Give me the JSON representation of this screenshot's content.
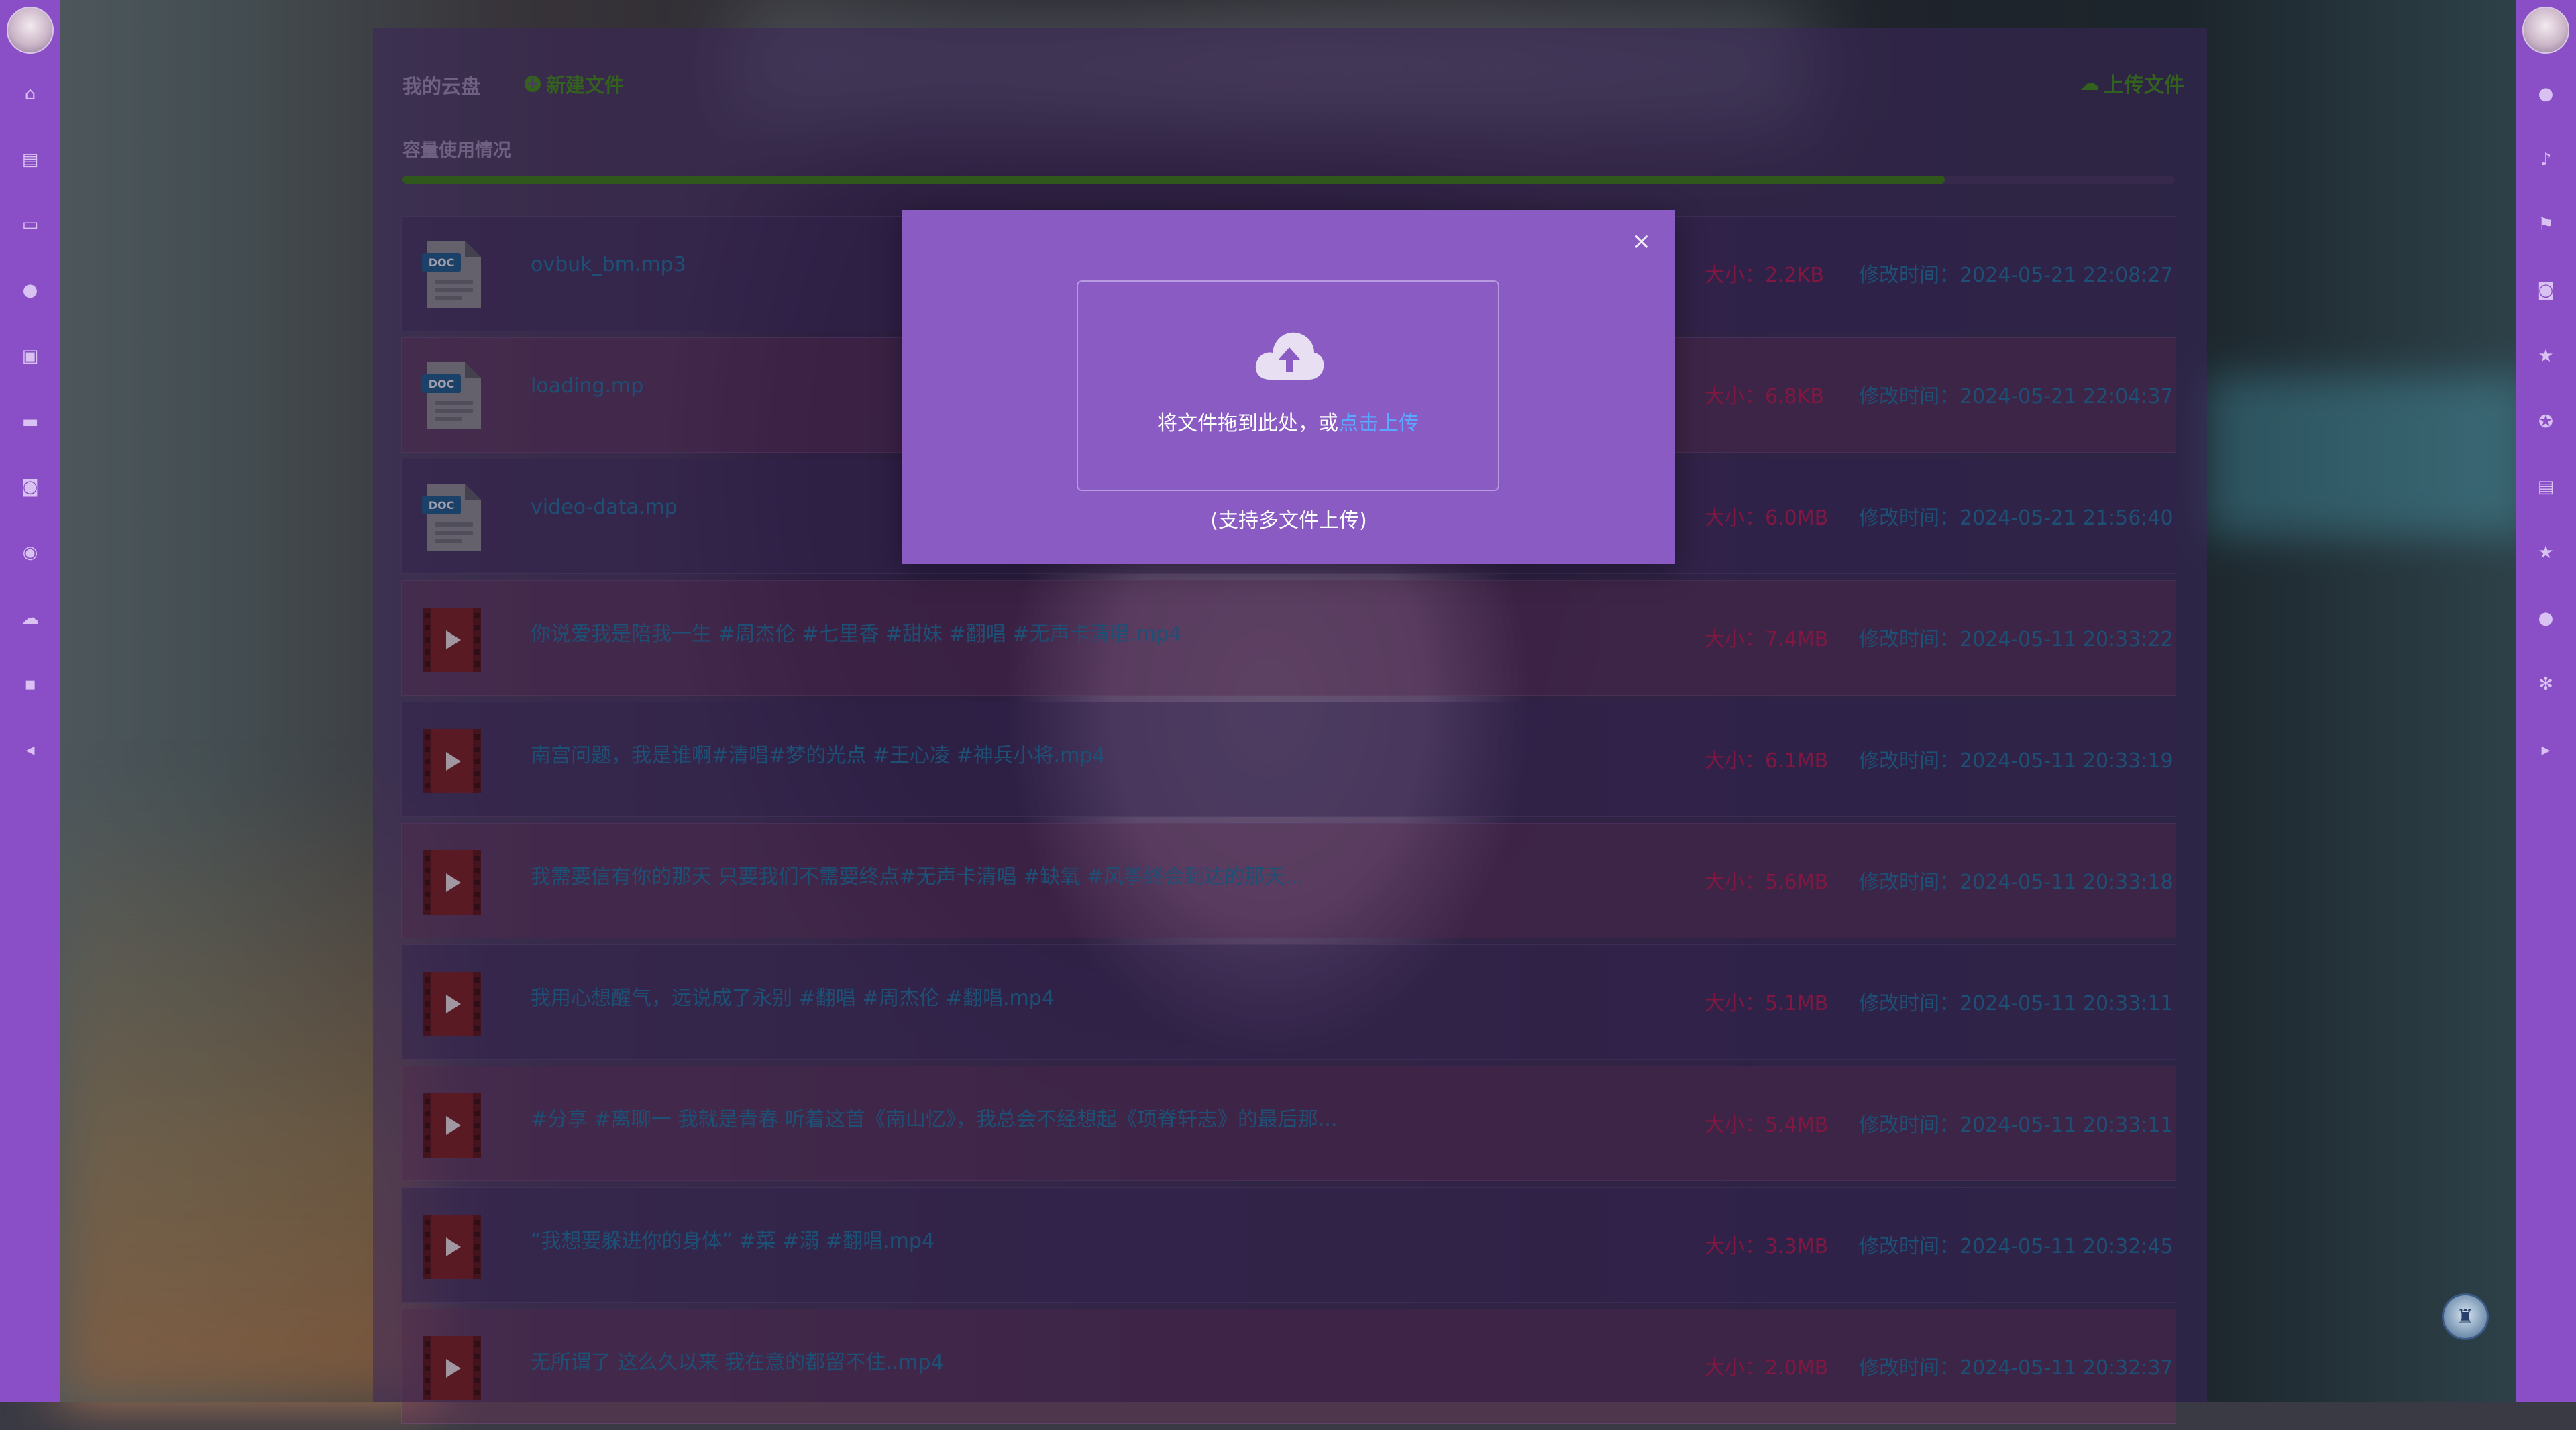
{
  "header": {
    "title": "我的云盘",
    "new_file_label": "新建文件",
    "upload_label": "上传文件",
    "capacity_label": "容量使用情况",
    "capacity_used_fraction": 0.87
  },
  "files": [
    {
      "name": "ovbuk_bm.mp3",
      "size": "大小：2.2KB",
      "modified": "修改时间：2024-05-21 22:08:27",
      "type": "doc"
    },
    {
      "name": "loading.mp",
      "size": "大小：6.8KB",
      "modified": "修改时间：2024-05-21 22:04:37",
      "type": "doc"
    },
    {
      "name": "video-data.mp",
      "size": "大小：6.0MB",
      "modified": "修改时间：2024-05-21 21:56:40",
      "type": "doc"
    },
    {
      "name": "你说爱我是陪我一生 #周杰伦 #七里香 #甜妹 #翻唱 #无声卡清唱.mp4",
      "size": "大小：7.4MB",
      "modified": "修改时间：2024-05-11 20:33:22",
      "type": "video"
    },
    {
      "name": "南宫问题，我是谁啊#清唱#梦的光点 #王心凌 #神兵小将.mp4",
      "size": "大小：6.1MB",
      "modified": "修改时间：2024-05-11 20:33:19",
      "type": "video"
    },
    {
      "name": "我需要信有你的那天 只要我们不需要终点#无声卡清唱 #缺氧 #风筝终会到达的那天...",
      "size": "大小：5.6MB",
      "modified": "修改时间：2024-05-11 20:33:18",
      "type": "video"
    },
    {
      "name": "我用心想醒气，远说成了永别 #翻唱 #周杰伦 #翻唱.mp4",
      "size": "大小：5.1MB",
      "modified": "修改时间：2024-05-11 20:33:11",
      "type": "video"
    },
    {
      "name": "#分享 #离聊一 我就是青春 听着这首《南山忆》，我总会不经想起《项脊轩志》的最后那...",
      "size": "大小：5.4MB",
      "modified": "修改时间：2024-05-11 20:33:11",
      "type": "video"
    },
    {
      "name": "“我想要躲进你的身体” #菜 #溺 #翻唱.mp4",
      "size": "大小：3.3MB",
      "modified": "修改时间：2024-05-11 20:32:45",
      "type": "video"
    },
    {
      "name": "无所谓了 这么久以来 我在意的都留不住..mp4",
      "size": "大小：2.0MB",
      "modified": "修改时间：2024-05-11 20:32:37",
      "type": "video"
    }
  ],
  "modal": {
    "close_symbol": "×",
    "drop_text": "将文件拖到此处，或",
    "drop_link": "点击上传",
    "multi_hint": "(支持多文件上传)"
  },
  "sidebar_left_icons": [
    "home-icon",
    "clipboard-icon",
    "monitor-icon",
    "user-icon",
    "checklist-icon",
    "monitor-icon",
    "camera-icon",
    "bulb-icon",
    "cloud-icon",
    "chat-icon",
    "collapse-left-icon"
  ],
  "sidebar_right_icons": [
    "user-icon",
    "bell-icon",
    "flag-icon",
    "camera-icon",
    "star-icon",
    "settings-circle-icon",
    "clipboard-icon",
    "star-icon",
    "user-icon",
    "gear-icon",
    "expand-right-icon"
  ],
  "colors": {
    "sidebar": "#8a4ec6",
    "modal": "#8a5bc3",
    "accent_green": "#3f8a14",
    "link_blue": "#5aa8ff",
    "file_name": "#1f6f9a",
    "file_size": "#b8194a"
  }
}
